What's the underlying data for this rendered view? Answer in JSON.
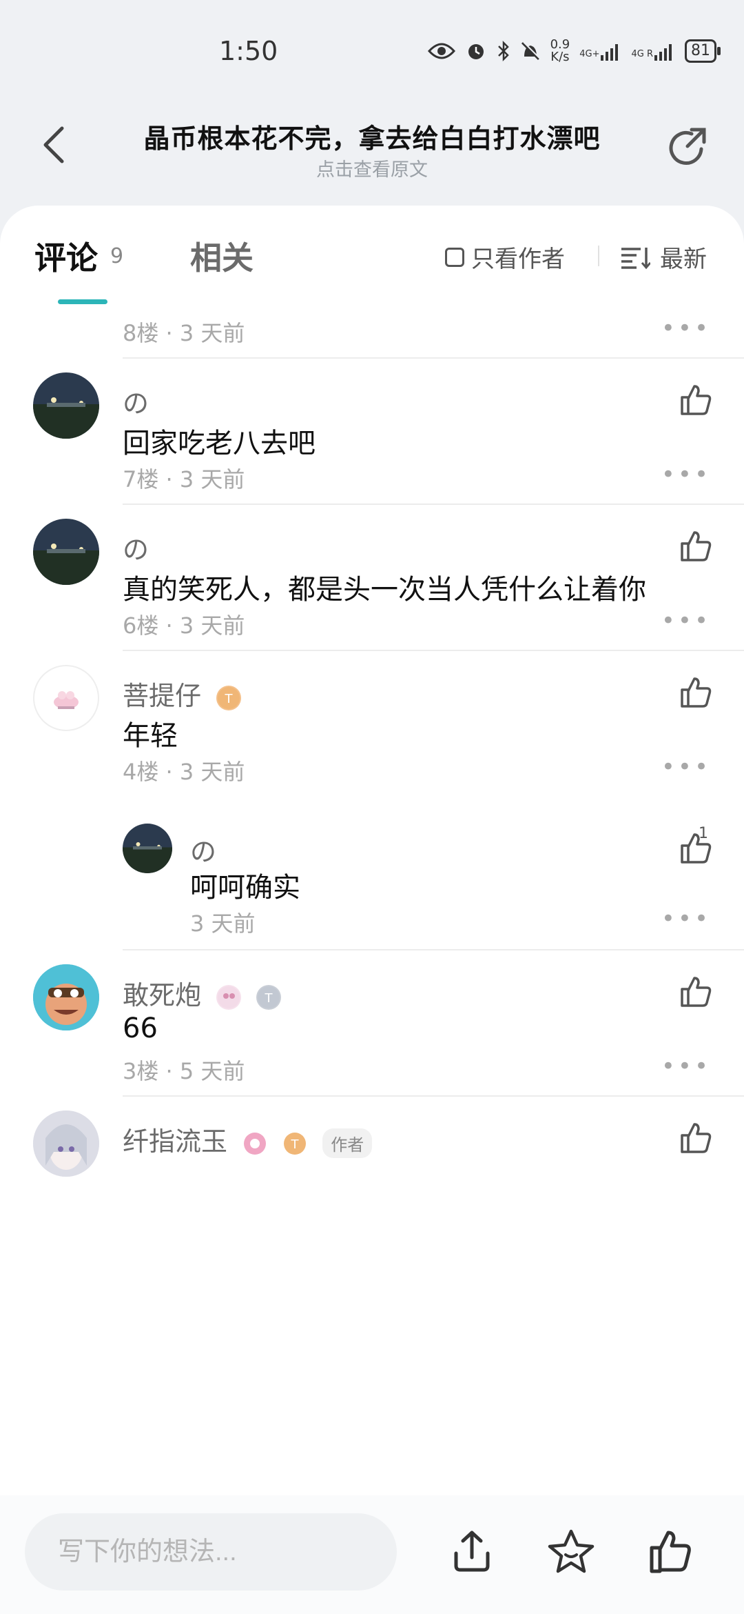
{
  "status_bar": {
    "time": "1:50",
    "net_speed_value": "0.9",
    "net_speed_unit": "K/s",
    "signal1": "4G+",
    "signal2": "4G R",
    "battery": "81"
  },
  "header": {
    "title": "晶币根本花不完，拿去给白白打水漂吧",
    "subtitle": "点击查看原文"
  },
  "tabs": {
    "comments_label": "评论",
    "comments_count": "9",
    "related_label": "相关",
    "only_author_label": "只看作者",
    "sort_label": "最新"
  },
  "comments": [
    {
      "meta": "8楼 · 3 天前"
    },
    {
      "user": "の",
      "text": "回家吃老八去吧",
      "meta": "7楼 · 3 天前"
    },
    {
      "user": "の",
      "text": "真的笑死人，都是头一次当人凭什么让着你",
      "meta": "6楼 · 3 天前"
    },
    {
      "user": "菩提仔",
      "text": "年轻",
      "meta": "4楼 · 3 天前",
      "reply": {
        "user": "の",
        "text": "呵呵确实",
        "meta": "3 天前",
        "likes": "1"
      }
    },
    {
      "user": "敢死炮",
      "text": "66",
      "meta": "3楼 · 5 天前"
    },
    {
      "user": "纤指流玉",
      "author_tag": "作者"
    }
  ],
  "bottom_bar": {
    "input_placeholder": "写下你的想法..."
  },
  "colors": {
    "accent": "#2cb5b8",
    "background": "#eff1f4"
  }
}
